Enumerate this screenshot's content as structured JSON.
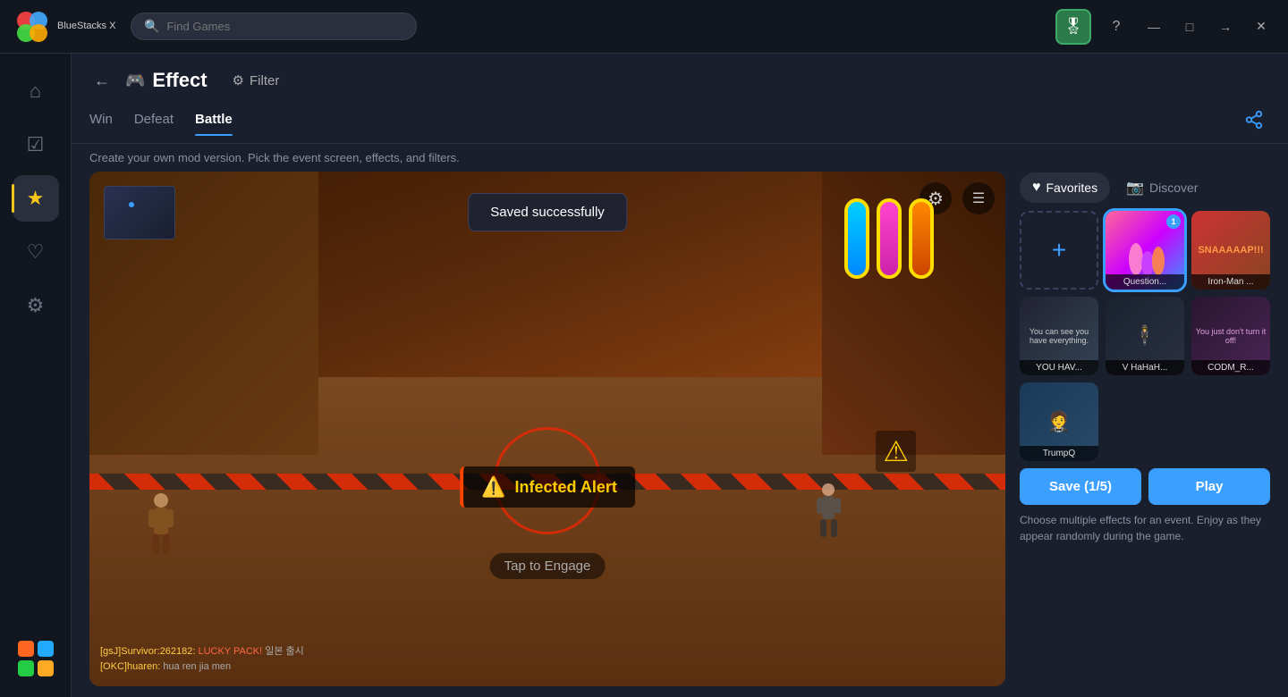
{
  "app": {
    "name": "BlueStacks X",
    "search_placeholder": "Find Games"
  },
  "titlebar": {
    "help_label": "?",
    "minimize_label": "—",
    "maximize_label": "□",
    "forward_label": "→",
    "close_label": "✕"
  },
  "sidebar": {
    "items": [
      {
        "id": "home",
        "icon": "⌂",
        "label": "Home"
      },
      {
        "id": "library",
        "icon": "☑",
        "label": "Library"
      },
      {
        "id": "favorites",
        "icon": "★",
        "label": "Favorites",
        "active": true
      },
      {
        "id": "heart",
        "icon": "♡",
        "label": "Wishlist"
      },
      {
        "id": "settings",
        "icon": "⚙",
        "label": "Settings"
      }
    ]
  },
  "header": {
    "back_label": "←",
    "page_icon": "🎮",
    "page_title": "Effect",
    "filter_icon": "⚙",
    "filter_label": "Filter",
    "share_icon": "⎋"
  },
  "tabs": {
    "items": [
      {
        "id": "win",
        "label": "Win"
      },
      {
        "id": "defeat",
        "label": "Defeat"
      },
      {
        "id": "battle",
        "label": "Battle",
        "active": true
      }
    ]
  },
  "description": "Create your own mod version. Pick the event screen, effects, and filters.",
  "toast": {
    "message": "Saved successfully"
  },
  "game": {
    "alert_text": "Infected Alert",
    "tap_text": "Tap to Engage",
    "chat_line1": "[gsJ]Survivor:262182:LUCKY PACK!일본 출시",
    "chat_line2": "[OKC]huaren:hua ren jia men"
  },
  "panel": {
    "favorites_label": "Favorites",
    "discover_label": "Discover",
    "favorites_icon": "♥",
    "discover_icon": "📷"
  },
  "effects_grid": {
    "add_label": "+",
    "items": [
      {
        "id": "question",
        "label": "Question...",
        "badge": "1",
        "type": "question",
        "selected": true
      },
      {
        "id": "ironman",
        "label": "Iron-Man ...",
        "badge": null,
        "type": "ironman"
      },
      {
        "id": "youhav",
        "label": "YOU HAV...",
        "badge": null,
        "type": "youhav"
      },
      {
        "id": "vhaha",
        "label": "V HaHaH...",
        "badge": null,
        "type": "vhaha"
      },
      {
        "id": "codm",
        "label": "CODM_R...",
        "badge": null,
        "type": "codm"
      },
      {
        "id": "trumpq",
        "label": "TrumpQ",
        "badge": null,
        "type": "trump"
      }
    ]
  },
  "buttons": {
    "save_label": "Save (1/5)",
    "play_label": "Play"
  },
  "hint": "Choose multiple effects for an event. Enjoy as they appear randomly during the game."
}
